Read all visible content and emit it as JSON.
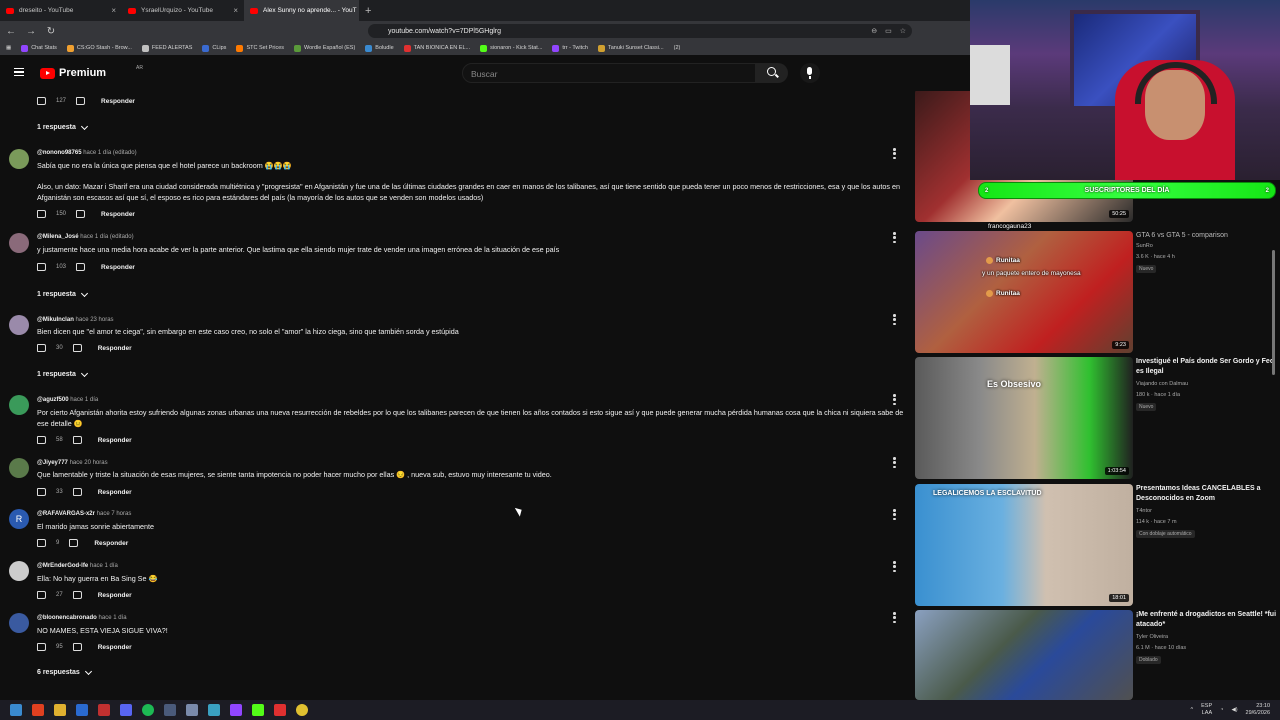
{
  "browser": {
    "tabs": [
      {
        "label": "dreseito - YouTube",
        "active": false
      },
      {
        "label": "YsraelUrquizo - YouTube",
        "active": false
      },
      {
        "label": "Alex Sunny no aprende... - YouT",
        "active": true
      }
    ],
    "new_tab": "+",
    "url": "youtube.com/watch?v=7DPl5GHglrg",
    "bookmarks": [
      "Chat Stats",
      "CS:GO Stash - Brow...",
      "FEED ALERTAS",
      "CLips",
      "STC Set Prices",
      "Wordle Español (ES)",
      "Boludle",
      "TAN BIONICA EN EL...",
      "sionaron - Kick Stat...",
      "trr - Twitch",
      "Tanuki Sunset Classi...",
      "(2)"
    ]
  },
  "youtube": {
    "logo": "Premium",
    "logo_sup": "AR",
    "search_placeholder": "Buscar"
  },
  "comments": [
    {
      "type": "actions",
      "likes": "127",
      "reply": "Responder"
    },
    {
      "type": "replies",
      "label": "1 respuesta"
    },
    {
      "type": "comment",
      "author": "@nonono98765",
      "time": "hace 1 día (editado)",
      "avatar_color": "#7a9a5a",
      "text": "Sabía que no era la única que piensa que el hotel parece un backroom 😭😭😭",
      "text2": "Also, un dato: Mazar i Sharif era una ciudad considerada multiétnica y \"progresista\" en Afganistán y fue una de las últimas ciudades grandes en caer en manos de los talibanes, así que tiene sentido que pueda tener un poco menos de restricciones, esa y que los autos en Afganistán son escasos así que sí, el esposo es rico para estándares del país (la mayoría de los autos que se venden son modelos usados)",
      "likes": "150",
      "reply": "Responder"
    },
    {
      "type": "comment",
      "author": "@Milena_José",
      "time": "hace 1 día (editado)",
      "avatar_color": "#8a6a7a",
      "text": "y justamente hace una media hora acabe de ver la parte anterior. Que lastima que ella siendo mujer trate de vender una imagen errónea de la situación de ese país",
      "likes": "103",
      "reply": "Responder"
    },
    {
      "type": "replies",
      "label": "1 respuesta"
    },
    {
      "type": "comment",
      "author": "@MikuInclan",
      "time": "hace 23 horas",
      "avatar_color": "#9a8aaa",
      "text": "Bien dicen que \"el amor te ciega\", sin embargo en este caso creo, no solo el \"amor\" la hizo ciega, sino que también sorda y estúpida",
      "likes": "30",
      "reply": "Responder"
    },
    {
      "type": "replies",
      "label": "1 respuesta"
    },
    {
      "type": "comment",
      "author": "@aguzf500",
      "time": "hace 1 día",
      "avatar_color": "#3a9a5a",
      "text": "Por cierto Afganistán ahorita estoy sufriendo algunas zonas urbanas una nueva resurrección de rebeldes por lo que los talibanes parecen de que tienen los años contados si esto sigue así y que puede generar mucha pérdida humanas cosa que la chica ni siquiera sabe de ese detalle 😐",
      "likes": "58",
      "reply": "Responder"
    },
    {
      "type": "comment",
      "author": "@Jiyey777",
      "time": "hace 20 horas",
      "avatar_color": "#5a7a4a",
      "text": "Que lamentable y triste la situación de esas mujeres, se siente tanta impotencia no poder hacer mucho por ellas 😔 , nueva sub, estuvo muy interesante tu video.",
      "likes": "33",
      "reply": "Responder"
    },
    {
      "type": "comment",
      "author": "@RAFAVARGAS-x2r",
      "time": "hace 7 horas",
      "avatar_color": "#2a5ab0",
      "avatar_letter": "R",
      "text": "El marido jamas sonrie abiertamente",
      "likes": "9",
      "reply": "Responder"
    },
    {
      "type": "comment",
      "author": "@MrEnderGod-lfe",
      "time": "hace 1 día",
      "avatar_color": "#cccccc",
      "text": "Ella: No hay guerra en Ba Sing Se 😂",
      "likes": "27",
      "reply": "Responder"
    },
    {
      "type": "comment",
      "author": "@bloonencabronado",
      "time": "hace 1 día",
      "avatar_color": "#3a5aa0",
      "text": "NO MAMES, ESTA VIEJA SIGUE VIVA?!",
      "likes": "95",
      "reply": "Responder"
    },
    {
      "type": "replies",
      "label": "6 respuestas"
    }
  ],
  "overlay": {
    "subscribers_label": "SUSCRIPTORES DEL DÍA",
    "sub_left": "2",
    "sub_right": "2",
    "chat": [
      {
        "user": "francogauna23",
        "message": ""
      },
      {
        "user": "Runitaa",
        "message": ""
      },
      {
        "user": "",
        "message": "y un paquete entero de mayonesa"
      },
      {
        "user": "Runitaa",
        "message": ""
      }
    ]
  },
  "sidebar": {
    "videos": [
      {
        "title": "",
        "channel": "",
        "meta": "",
        "duration": "50:25"
      },
      {
        "title": "GTA 6 vs GTA 5 - comparison",
        "channel": "SunRo",
        "meta": "3.6 K · hace 4 h",
        "badge": "Nuevo",
        "duration": "9:23"
      },
      {
        "title": "Investigué el País donde Ser Gordo y Feo es Ilegal",
        "channel": "Viajando con Dalmau",
        "meta": "180 k · hace 1 día",
        "badge": "Nuevo",
        "duration": "1:03:54",
        "thumb_text": "Es Obsesivo"
      },
      {
        "title": "Presentamos Ideas CANCELABLES a Desconocidos en Zoom",
        "channel": "T4ntor",
        "meta": "114 k · hace 7 m",
        "badge": "Con doblaje automático",
        "duration": "18:01",
        "thumb_text": "LEGALICEMOS LA ESCLAVITUD"
      },
      {
        "title": "¡Me enfrenté a drogadictos en Seattle! *fui atacado*",
        "channel": "Tyler Oliveira",
        "meta": "6.1 M · hace 10 días",
        "badge": "Doblado",
        "duration": ""
      }
    ]
  },
  "taskbar": {
    "lang": "ESP",
    "lang2": "LAA",
    "time": "23:10",
    "date": "29/6/2026"
  }
}
